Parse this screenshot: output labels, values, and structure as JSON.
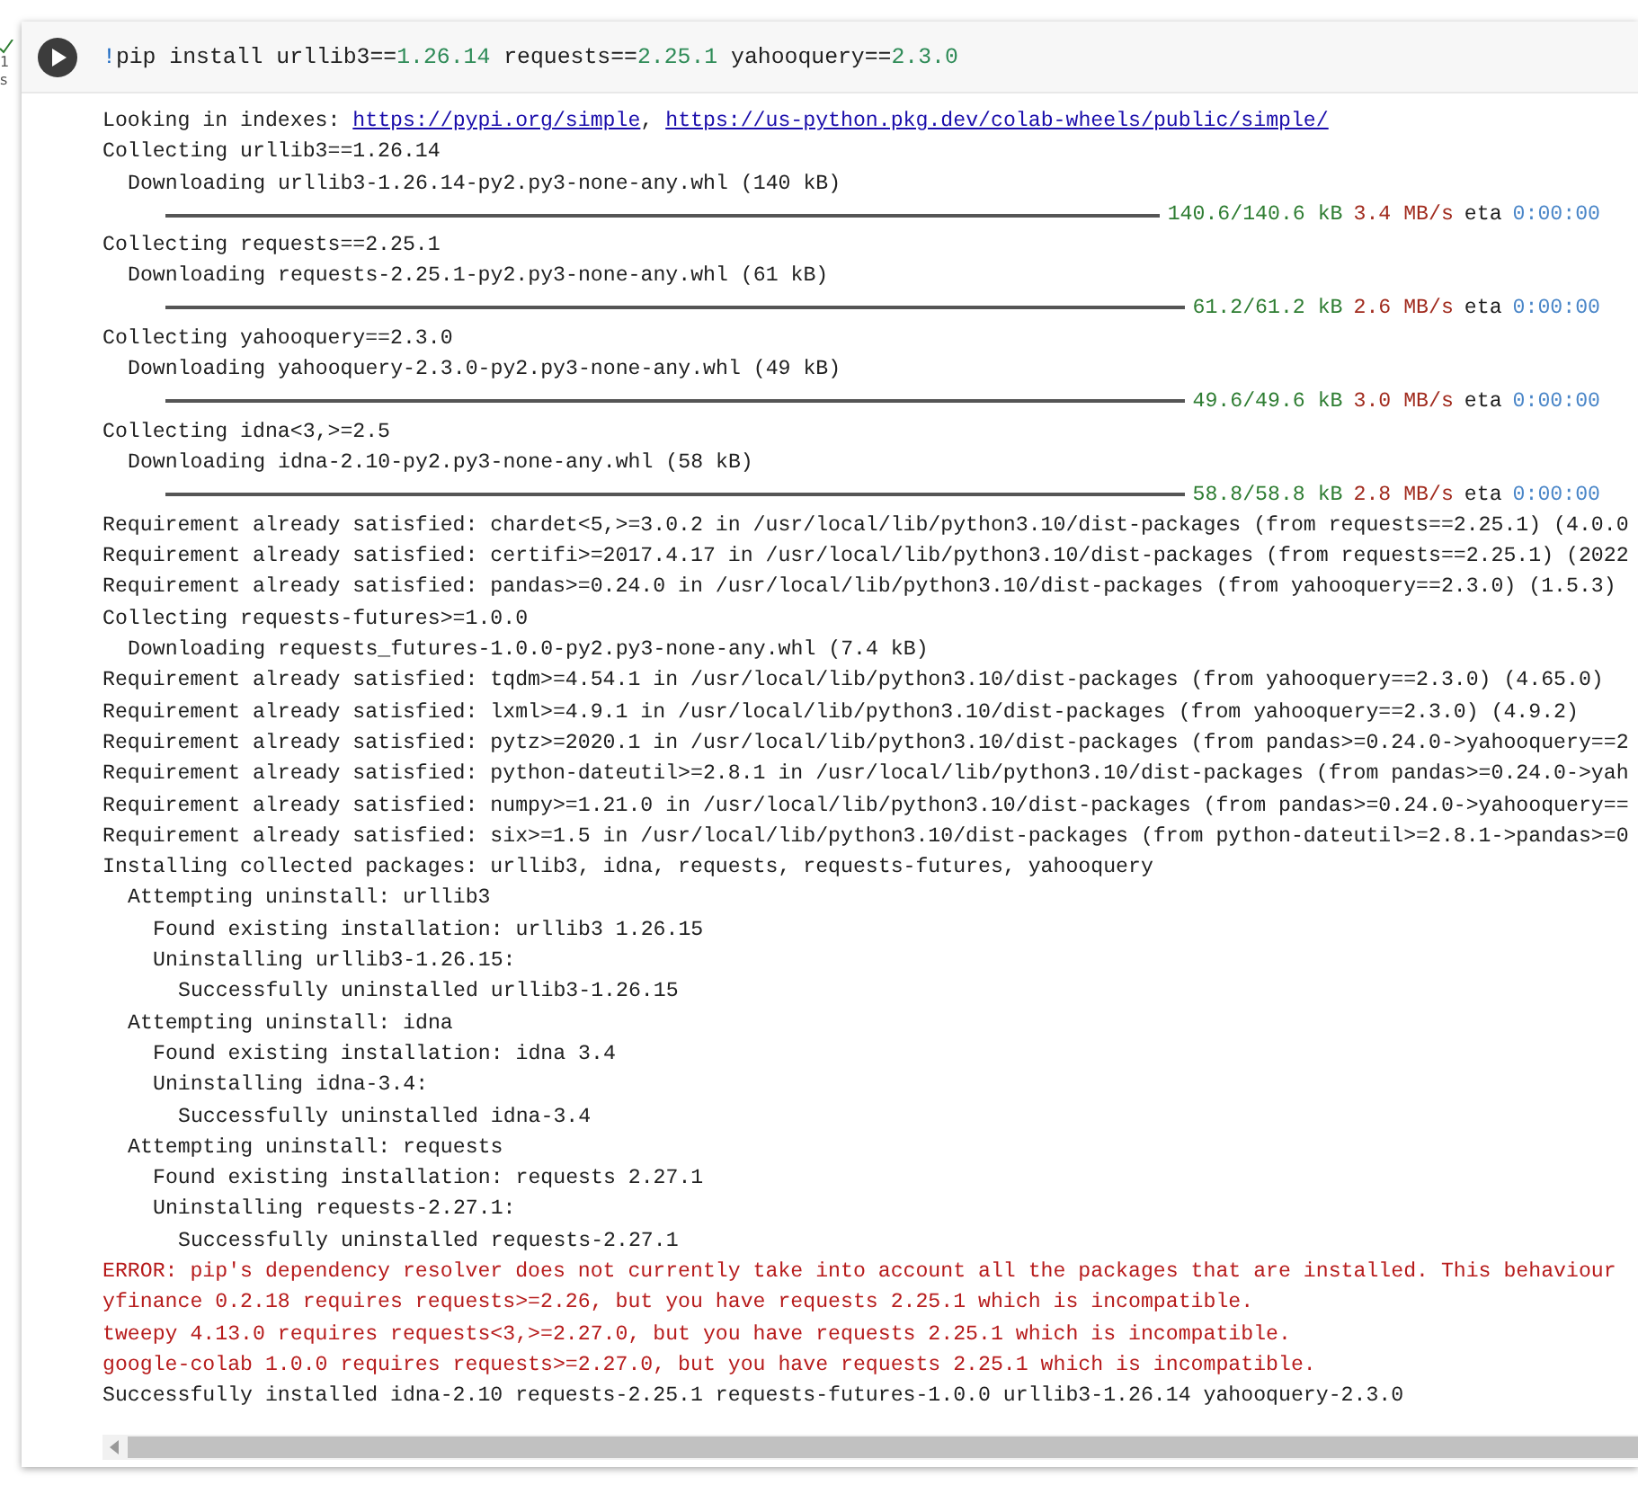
{
  "gutter": {
    "done": true,
    "exec_time": [
      "1",
      "s"
    ]
  },
  "cell": {
    "code": [
      {
        "kind": "op",
        "text": "!"
      },
      {
        "kind": "text",
        "text": "pip install urllib3=="
      },
      {
        "kind": "num",
        "text": "1.26.14"
      },
      {
        "kind": "text",
        "text": " requests=="
      },
      {
        "kind": "num",
        "text": "2.25.1"
      },
      {
        "kind": "text",
        "text": " yahooquery=="
      },
      {
        "kind": "num",
        "text": "2.3.0"
      }
    ],
    "output": [
      {
        "kind": "links",
        "parts": [
          {
            "kind": "text",
            "text": "Looking in indexes: "
          },
          {
            "kind": "link",
            "text": "https://pypi.org/simple"
          },
          {
            "kind": "text",
            "text": ", "
          },
          {
            "kind": "link",
            "text": "https://us-python.pkg.dev/colab-wheels/public/simple/"
          }
        ]
      },
      {
        "kind": "text",
        "text": "Collecting urllib3==1.26.14",
        "children": [
          {
            "kind": "text",
            "text": "Downloading urllib3-1.26.14-py2.py3-none-any.whl (140 kB)",
            "children": [
              {
                "kind": "progress",
                "level": 1,
                "size": "140.6/140.6 kB",
                "speed": "3.4 MB/s",
                "eta_label": "eta",
                "eta": "0:00:00"
              }
            ]
          }
        ]
      },
      {
        "kind": "text",
        "text": "Collecting requests==2.25.1",
        "children": [
          {
            "kind": "text",
            "text": "Downloading requests-2.25.1-py2.py3-none-any.whl (61 kB)",
            "children": [
              {
                "kind": "progress",
                "level": 1,
                "size": "61.2/61.2 kB",
                "speed": "2.6 MB/s",
                "eta_label": "eta",
                "eta": "0:00:00"
              }
            ]
          }
        ]
      },
      {
        "kind": "text",
        "text": "Collecting yahooquery==2.3.0",
        "children": [
          {
            "kind": "text",
            "text": "Downloading yahooquery-2.3.0-py2.py3-none-any.whl (49 kB)",
            "children": [
              {
                "kind": "progress",
                "level": 1,
                "size": "49.6/49.6 kB",
                "speed": "3.0 MB/s",
                "eta_label": "eta",
                "eta": "0:00:00"
              }
            ]
          }
        ]
      },
      {
        "kind": "text",
        "text": "Collecting idna<3,>=2.5",
        "children": [
          {
            "kind": "text",
            "text": "Downloading idna-2.10-py2.py3-none-any.whl (58 kB)",
            "children": [
              {
                "kind": "progress",
                "level": 1,
                "size": "58.8/58.8 kB",
                "speed": "2.8 MB/s",
                "eta_label": "eta",
                "eta": "0:00:00"
              }
            ]
          }
        ]
      },
      {
        "kind": "text",
        "text": "Requirement already satisfied: chardet<5,>=3.0.2 in /usr/local/lib/python3.10/dist-packages (from requests==2.25.1) (4.0.0"
      },
      {
        "kind": "text",
        "text": "Requirement already satisfied: certifi>=2017.4.17 in /usr/local/lib/python3.10/dist-packages (from requests==2.25.1) (2022"
      },
      {
        "kind": "text",
        "text": "Requirement already satisfied: pandas>=0.24.0 in /usr/local/lib/python3.10/dist-packages (from yahooquery==2.3.0) (1.5.3)"
      },
      {
        "kind": "text",
        "text": "Collecting requests-futures>=1.0.0",
        "children": [
          {
            "kind": "text",
            "text": "Downloading requests_futures-1.0.0-py2.py3-none-any.whl (7.4 kB)"
          }
        ]
      },
      {
        "kind": "text",
        "text": "Requirement already satisfied: tqdm>=4.54.1 in /usr/local/lib/python3.10/dist-packages (from yahooquery==2.3.0) (4.65.0)"
      },
      {
        "kind": "text",
        "text": "Requirement already satisfied: lxml>=4.9.1 in /usr/local/lib/python3.10/dist-packages (from yahooquery==2.3.0) (4.9.2)"
      },
      {
        "kind": "text",
        "text": "Requirement already satisfied: pytz>=2020.1 in /usr/local/lib/python3.10/dist-packages (from pandas>=0.24.0->yahooquery==2"
      },
      {
        "kind": "text",
        "text": "Requirement already satisfied: python-dateutil>=2.8.1 in /usr/local/lib/python3.10/dist-packages (from pandas>=0.24.0->yah"
      },
      {
        "kind": "text",
        "text": "Requirement already satisfied: numpy>=1.21.0 in /usr/local/lib/python3.10/dist-packages (from pandas>=0.24.0->yahooquery=="
      },
      {
        "kind": "text",
        "text": "Requirement already satisfied: six>=1.5 in /usr/local/lib/python3.10/dist-packages (from python-dateutil>=2.8.1->pandas>=0"
      },
      {
        "kind": "text",
        "text": "Installing collected packages: urllib3, idna, requests, requests-futures, yahooquery",
        "children": [
          {
            "kind": "text",
            "text": "Attempting uninstall: urllib3",
            "children": [
              {
                "kind": "text",
                "text": "Found existing installation: urllib3 1.26.15"
              },
              {
                "kind": "text",
                "text": "Uninstalling urllib3-1.26.15:",
                "children": [
                  {
                    "kind": "text",
                    "text": "Successfully uninstalled urllib3-1.26.15"
                  }
                ]
              }
            ]
          },
          {
            "kind": "text",
            "text": "Attempting uninstall: idna",
            "children": [
              {
                "kind": "text",
                "text": "Found existing installation: idna 3.4"
              },
              {
                "kind": "text",
                "text": "Uninstalling idna-3.4:",
                "children": [
                  {
                    "kind": "text",
                    "text": "Successfully uninstalled idna-3.4"
                  }
                ]
              }
            ]
          },
          {
            "kind": "text",
            "text": "Attempting uninstall: requests",
            "children": [
              {
                "kind": "text",
                "text": "Found existing installation: requests 2.27.1"
              },
              {
                "kind": "text",
                "text": "Uninstalling requests-2.27.1:",
                "children": [
                  {
                    "kind": "text",
                    "text": "Successfully uninstalled requests-2.27.1"
                  }
                ]
              }
            ]
          }
        ]
      },
      {
        "kind": "error",
        "text": "ERROR: pip's dependency resolver does not currently take into account all the packages that are installed. This behaviour"
      },
      {
        "kind": "error",
        "text": "yfinance 0.2.18 requires requests>=2.26, but you have requests 2.25.1 which is incompatible."
      },
      {
        "kind": "error",
        "text": "tweepy 4.13.0 requires requests<3,>=2.27.0, but you have requests 2.25.1 which is incompatible."
      },
      {
        "kind": "error",
        "text": "google-colab 1.0.0 requires requests>=2.27.0, but you have requests 2.25.1 which is incompatible."
      },
      {
        "kind": "text",
        "text": "Successfully installed idna-2.10 requests-2.25.1 requests-futures-1.0.0 urllib3-1.26.14 yahooquery-2.3.0"
      }
    ]
  }
}
